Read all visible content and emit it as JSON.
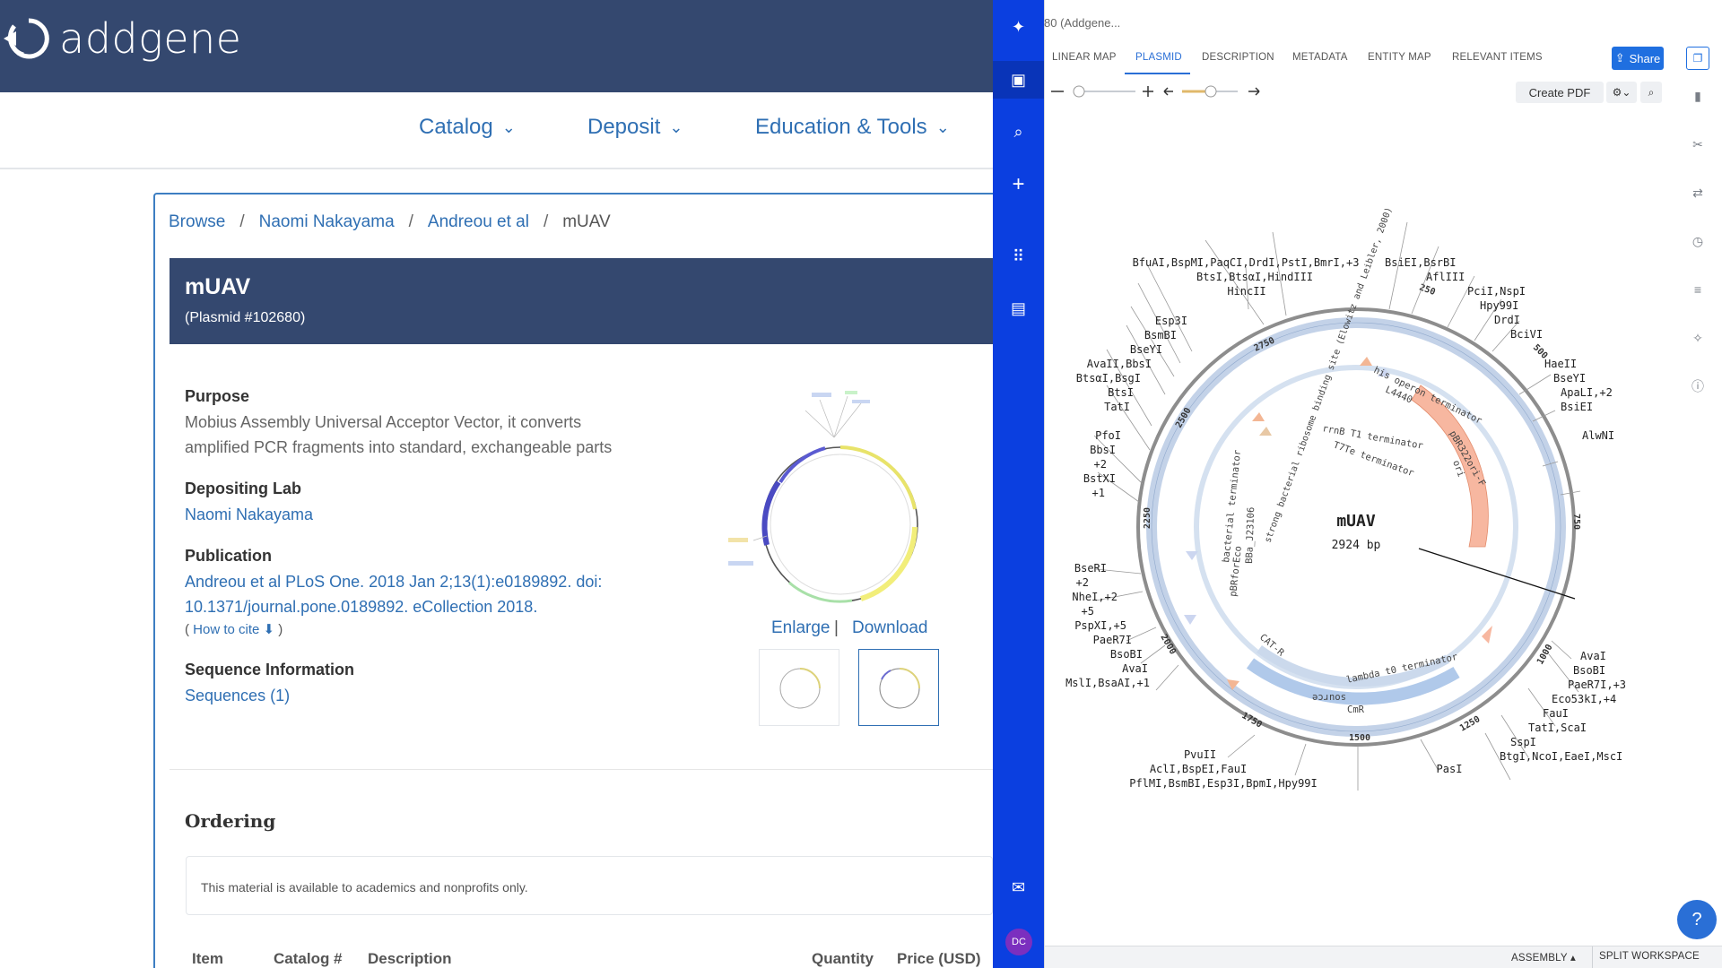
{
  "addgene": {
    "logo_text": "addgene",
    "nav": [
      {
        "label": "Catalog"
      },
      {
        "label": "Deposit"
      },
      {
        "label": "Education & Tools"
      }
    ],
    "breadcrumb": [
      "Browse",
      "Naomi Nakayama",
      "Andreou et al",
      "mUAV"
    ],
    "title": "mUAV",
    "plasmid_id": "(Plasmid #102680)",
    "purpose_heading": "Purpose",
    "purpose_line1": "Mobius Assembly Universal Acceptor Vector, it converts",
    "purpose_line2": "amplified PCR fragments into standard, exchangeable parts",
    "lab_heading": "Depositing Lab",
    "lab_name": "Naomi Nakayama",
    "publication_heading": "Publication",
    "publication_line1": "Andreou et al PLoS One. 2018 Jan 2;13(1):e0189892. doi:",
    "publication_line2": "10.1371/journal.pone.0189892. eCollection 2018.",
    "how_to_cite": "How to cite",
    "seq_heading": "Sequence Information",
    "sequences_link": "Sequences (1)",
    "enlarge": "Enlarge",
    "download": "Download",
    "ordering_heading": "Ordering",
    "availability": "This material is available to academics and nonprofits only.",
    "table_headers": [
      "Item",
      "Catalog #",
      "Description",
      "Quantity",
      "Price (USD)"
    ]
  },
  "benchling": {
    "doc_title": "80 (Addgene...",
    "tabs": [
      "LINEAR MAP",
      "PLASMID",
      "DESCRIPTION",
      "METADATA",
      "ENTITY MAP",
      "RELEVANT ITEMS"
    ],
    "active_tab": "PLASMID",
    "share_label": "Share",
    "create_pdf": "Create PDF",
    "avatar_initials": "DC",
    "bottom": {
      "assembly": "ASSEMBLY",
      "split": "SPLIT WORKSPACE"
    },
    "help": "?",
    "plasmid": {
      "name": "mUAV",
      "length": "2924 bp",
      "ticks": [
        "250",
        "500",
        "750",
        "1000",
        "1250",
        "1500",
        "1750",
        "2000",
        "2250",
        "2500",
        "2750"
      ],
      "features": [
        "his operon terminator",
        "L4440",
        "pBR322ori-F",
        "ori",
        "rrnB T1 terminator",
        "T7Te terminator",
        "strong bacterial ribosome binding site (Elowitz and Leibler, 2000)",
        "BBa_J23106",
        "bacterial terminator",
        "pBRforEco",
        "CAT-R",
        "lambda t0 terminator",
        "source",
        "CmR"
      ],
      "labels_top_left": [
        "BfuAI,BspMI,PaqCI,DrdI,PstI,BmrI,+3",
        "BtsI,BtsαI,HindIII",
        "HincII"
      ],
      "labels_left": [
        "Esp3I",
        "BsmBI",
        "BseYI",
        "AvaII,BbsI",
        "BtsαI,BsgI",
        "BtsI",
        "TatI",
        "PfoI",
        "BbsI",
        "+2",
        "BstXI",
        "+1",
        "BseRI",
        "+2",
        "NheI,+2",
        "+5",
        "PspXI,+5",
        "PaeR7I",
        "BsoBI",
        "AvaI",
        "MslI,BsaAI,+1"
      ],
      "labels_bottom": [
        "PvuII",
        "AclI,BspEI,FauI",
        "PflMI,BsmBI,Esp3I,BpmI,Hpy99I",
        "PasI"
      ],
      "labels_top_right": [
        "BsiEI,BsrBI",
        "AflIII",
        "PciI,NspI",
        "Hpy99I",
        "DrdI",
        "BciVI"
      ],
      "labels_right": [
        "HaeII",
        "BseYI",
        "ApaLI,+2",
        "BsiEI",
        "AlwNI",
        "AvaI",
        "BsoBI",
        "PaeR7I,+3",
        "Eco53kI,+4",
        "FauI",
        "TatI,ScaI",
        "SspI",
        "BtgI,NcoI,EaeI,MscI"
      ]
    },
    "colors": {
      "sidebar": "#0b3fe0",
      "accent": "#2a6fd6",
      "feature_blue": "#b9cbe6",
      "feature_orange": "#f6b39b"
    }
  }
}
